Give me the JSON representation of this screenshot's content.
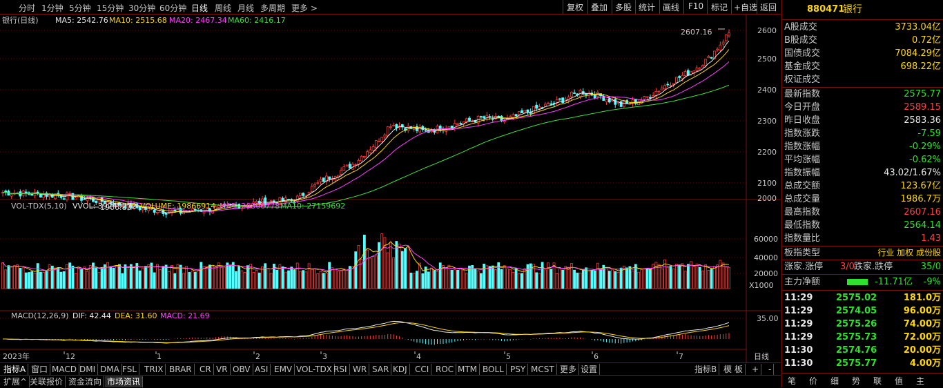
{
  "toolbar": {
    "periods": [
      "分时",
      "1分钟",
      "5分钟",
      "15分钟",
      "30分钟",
      "60分钟",
      "日线",
      "周线",
      "月线",
      "多周期",
      "更多 >"
    ],
    "active_period": "日线",
    "right_buttons": [
      "复权",
      "叠加",
      "多股",
      "统计",
      "画线",
      "F10",
      "标记",
      "+自选",
      "返回"
    ]
  },
  "main_chart": {
    "title": "银行(日线)",
    "ma5_label": "MA5: 2542.76",
    "ma10_label": "MA10: 2515.68",
    "ma20_label": "MA20: 2467.34",
    "ma60_label": "MA60: 2416.17",
    "high_marker": "2607.16",
    "low_marker": "1966.83",
    "price_ticks": [
      "2600",
      "2500",
      "2400",
      "2300",
      "2200",
      "2100",
      "2000"
    ]
  },
  "volume_chart": {
    "title": "VOL-TDX(5,10)",
    "vvol": "VVOL: 39249272",
    "volume": "VOLUME: 19866914",
    "ma5": "MA5: 26300778",
    "ma10": "MA10: 27159692",
    "ticks": [
      "60000",
      "40000",
      "20000"
    ],
    "unit": "X1000"
  },
  "macd_chart": {
    "title": "MACD(12,26,9)",
    "dif": "DIF: 42.44",
    "dea": "DEA: 31.60",
    "macd": "MACD: 21.69",
    "tick": "35.00"
  },
  "time_axis": {
    "labels": [
      "2023年",
      "12",
      "1",
      "2",
      "3",
      "4",
      "5",
      "6",
      "7"
    ],
    "period_label": "日线"
  },
  "bottom_tabs_1": [
    "指标A",
    "窗口",
    "MACD",
    "DMI",
    "DMA",
    "FSL",
    "TRIX",
    "BRAR",
    "CR",
    "VR",
    "OBV",
    "ASI",
    "EMV",
    "VOL-TDX",
    "RSI",
    "WR",
    "SAR",
    "KDJ",
    "CCI",
    "ROC",
    "MTM",
    "BOLL",
    "PSY",
    "MCST",
    "更多",
    "设置"
  ],
  "bottom_tabs_1_right": [
    "指标B",
    "模 板",
    "+",
    "-"
  ],
  "bottom_tabs_2": [
    "扩展^",
    "关联报价",
    "资金流向",
    "市场资讯"
  ],
  "right_panel": {
    "code": "880471",
    "name": "银行",
    "market_rows": [
      {
        "label": "A股成交",
        "value": "3733.04亿"
      },
      {
        "label": "B股成交",
        "value": "0.72亿"
      },
      {
        "label": "国债成交",
        "value": "7084.29亿"
      },
      {
        "label": "基金成交",
        "value": "698.22亿"
      },
      {
        "label": "权证成交",
        "value": ""
      }
    ],
    "index_rows": [
      {
        "label": "最新指数",
        "value": "2575.77",
        "color": "green"
      },
      {
        "label": "今日开盘",
        "value": "2589.15",
        "color": "red"
      },
      {
        "label": "昨日收盘",
        "value": "2583.36",
        "color": "white"
      },
      {
        "label": "指数涨跌",
        "value": "-7.59",
        "color": "green"
      },
      {
        "label": "指数涨幅",
        "value": "-0.29%",
        "color": "green"
      },
      {
        "label": "平均涨幅",
        "value": "-0.62%",
        "color": "green"
      },
      {
        "label": "指数振幅",
        "value": "43.02/1.67%",
        "color": "white"
      },
      {
        "label": "总成交额",
        "value": "123.67亿",
        "color": "yellow"
      },
      {
        "label": "总成交量",
        "value": "1986.7万",
        "color": "yellow"
      },
      {
        "label": "最高指数",
        "value": "2607.16",
        "color": "red"
      },
      {
        "label": "最低指数",
        "value": "2564.14",
        "color": "green"
      },
      {
        "label": "指数量比",
        "value": "1.43",
        "color": "red"
      }
    ],
    "type_label": "板指类型",
    "type_value": "行业 加权 成份股",
    "up_label": "涨家.涨停",
    "up_value": "3/0",
    "down_label": "跌家.跌停",
    "down_value": "35/0",
    "net_label": "主力净额",
    "net_value": "-11.71亿",
    "net_pct": "-9%",
    "ticks": [
      {
        "time": "11:29",
        "price": "2575.02",
        "vol": "181.0万"
      },
      {
        "time": "11:29",
        "price": "2574.05",
        "vol": "96.00万"
      },
      {
        "time": "11:29",
        "price": "2575.26",
        "vol": "74.00万"
      },
      {
        "time": "11:29",
        "price": "2575.73",
        "vol": "72.00万"
      },
      {
        "time": "11:30",
        "price": "2574.76",
        "vol": "20.00万"
      },
      {
        "time": "11:30",
        "price": "2575.77",
        "vol": "4.00万"
      }
    ],
    "bottom_tabs": [
      "笔",
      "价",
      "细",
      "势",
      "联",
      "值",
      "主"
    ]
  }
}
